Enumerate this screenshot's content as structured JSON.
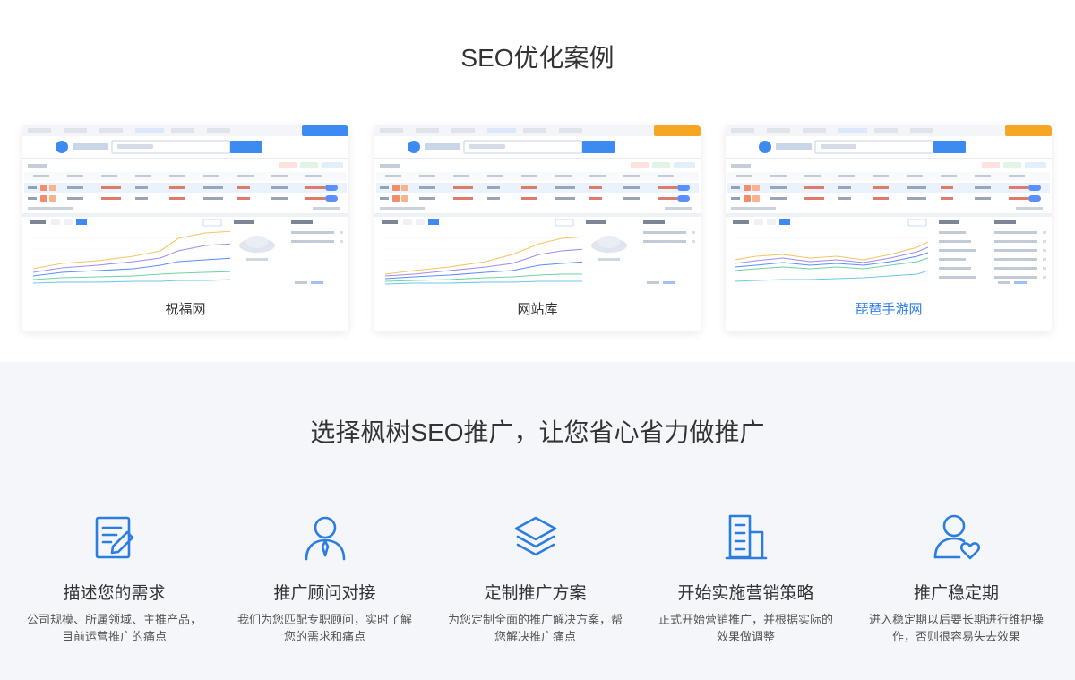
{
  "cases_section": {
    "title": "SEO优化案例",
    "cases": [
      {
        "name": "祝福网",
        "caption_color": "#333333",
        "badge_color": "#3d8bf2"
      },
      {
        "name": "网站库",
        "caption_color": "#333333",
        "badge_color": "#f5a623"
      },
      {
        "name": "琵琶手游网",
        "caption_color": "#2f80ed",
        "badge_color": "#f5a623"
      }
    ]
  },
  "steps_section": {
    "title": "选择枫树SEO推广，让您省心省力做推广",
    "accent_color": "#2b7de0",
    "steps": [
      {
        "icon": "document-edit-icon",
        "title": "描述您的需求",
        "desc": [
          "公司规模、所属领域、主推产品，",
          "目前运营推广的痛点"
        ]
      },
      {
        "icon": "consultant-icon",
        "title": "推广顾问对接",
        "desc": [
          "我们为您匹配专职顾问，实时了解",
          "您的需求和痛点"
        ]
      },
      {
        "icon": "layers-icon",
        "title": "定制推广方案",
        "desc": [
          "为您定制全面的推广解决方案，帮",
          "您解决推广痛点"
        ]
      },
      {
        "icon": "building-icon",
        "title": "开始实施营销策略",
        "desc": [
          "正式开始营销推广，并根据实际的",
          "效果做调整"
        ]
      },
      {
        "icon": "user-heart-icon",
        "title": "推广稳定期",
        "desc": [
          "进入稳定期以后要长期进行维护操",
          "作，否则很容易失去效果"
        ]
      }
    ]
  }
}
